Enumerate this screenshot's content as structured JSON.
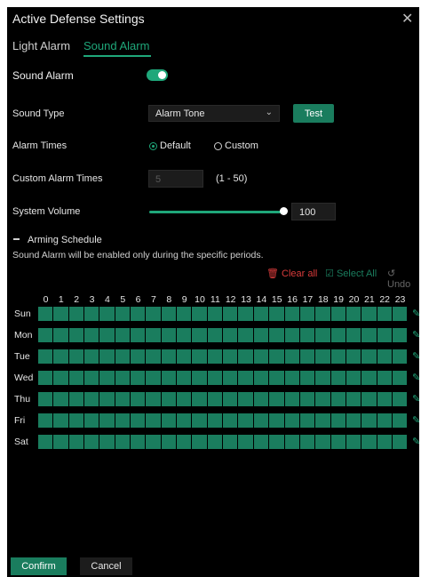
{
  "dialog": {
    "title": "Active Defense Settings",
    "close_icon": "close-icon"
  },
  "tabs": [
    {
      "label": "Light Alarm",
      "active": false
    },
    {
      "label": "Sound Alarm",
      "active": true
    }
  ],
  "form": {
    "sound_alarm_label": "Sound Alarm",
    "sound_alarm_enabled": true,
    "sound_type_label": "Sound Type",
    "sound_type_value": "Alarm Tone",
    "test_label": "Test",
    "alarm_times_label": "Alarm Times",
    "alarm_times_options": [
      {
        "label": "Default",
        "checked": true
      },
      {
        "label": "Custom",
        "checked": false
      }
    ],
    "custom_alarm_times_label": "Custom Alarm Times",
    "custom_alarm_times_value": "5",
    "custom_alarm_times_range": "(1 - 50)",
    "system_volume_label": "System Volume",
    "system_volume_value": "100"
  },
  "schedule": {
    "section_label": "Arming Schedule",
    "hint": "Sound Alarm will be enabled only during the specific periods.",
    "clear_all_label": "Clear all",
    "select_all_label": "Select All",
    "undo_label": "Undo",
    "hours": [
      "0",
      "1",
      "2",
      "3",
      "4",
      "5",
      "6",
      "7",
      "8",
      "9",
      "10",
      "11",
      "12",
      "13",
      "14",
      "15",
      "16",
      "17",
      "18",
      "19",
      "20",
      "21",
      "22",
      "23"
    ],
    "days": [
      "Sun",
      "Mon",
      "Tue",
      "Wed",
      "Thu",
      "Fri",
      "Sat"
    ],
    "all_selected": true
  },
  "footer": {
    "confirm_label": "Confirm",
    "cancel_label": "Cancel"
  },
  "colors": {
    "accent": "#1fa77a",
    "cell": "#1a7d5e",
    "danger": "#d93b3b",
    "background": "#000000"
  }
}
